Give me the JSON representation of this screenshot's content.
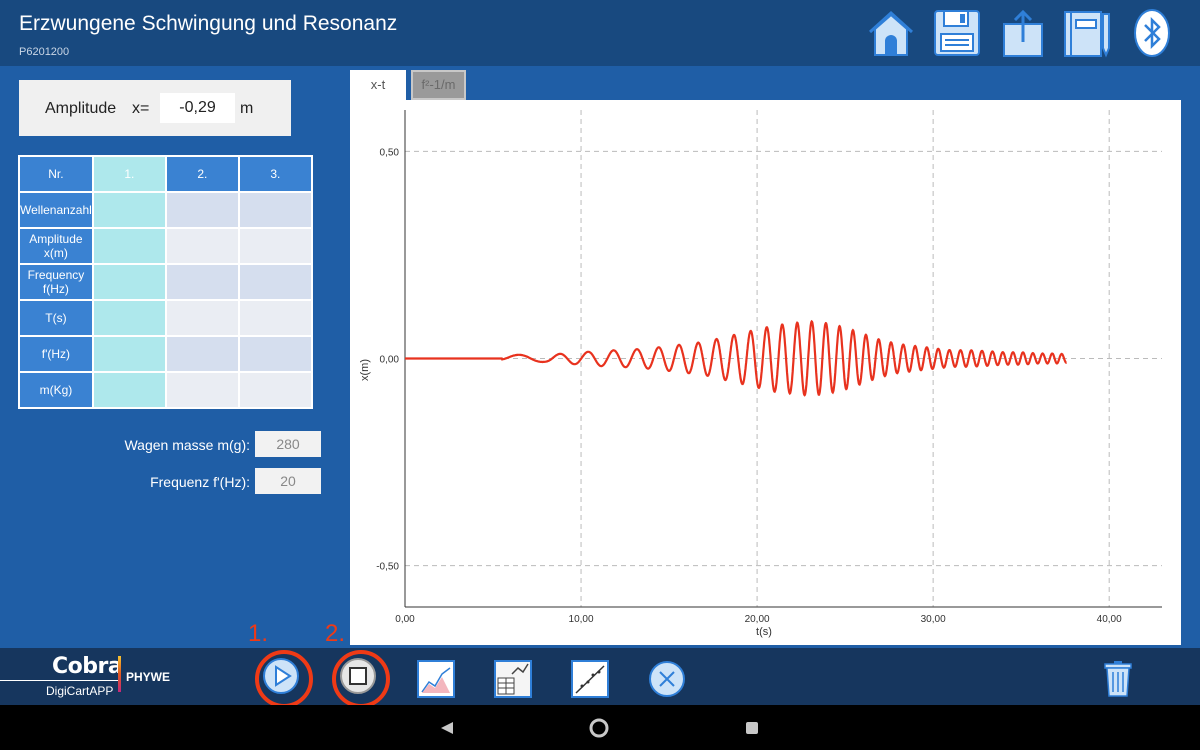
{
  "header": {
    "title": "Erzwungene Schwingung und Resonanz",
    "subtitle": "P6201200",
    "icons": [
      "home-icon",
      "save-icon",
      "export-icon",
      "notebook-icon",
      "bluetooth-icon"
    ]
  },
  "amplitude": {
    "label": "Amplitude",
    "var": "x=",
    "value": "-0,29",
    "unit": "m"
  },
  "table": {
    "corner": "Nr.",
    "columns": [
      "1.",
      "2.",
      "3."
    ],
    "rows": [
      "Wellenanzahl",
      "Amplitude x(m)",
      "Frequency f(Hz)",
      "T(s)",
      "f'(Hz)",
      "m(Kg)"
    ]
  },
  "fields": {
    "mass_label": "Wagen masse m(g):",
    "mass_value": "280",
    "freq_label": "Frequenz f'(Hz):",
    "freq_value": "20"
  },
  "tabs": {
    "xt": "x-t",
    "f2": "f²-1/m"
  },
  "chart_data": {
    "type": "line",
    "xlabel": "t(s)",
    "ylabel": "x(m)",
    "xlim": [
      0,
      43
    ],
    "ylim": [
      -0.6,
      0.6
    ],
    "x_ticks": [
      "0,00",
      "10,00",
      "20,00",
      "30,00",
      "40,00"
    ],
    "y_ticks": [
      "0,50",
      "0,00",
      "-0,50"
    ],
    "grid": true,
    "color": "#e8321e",
    "series": [
      {
        "x": [
          0,
          5,
          5.5,
          6,
          7,
          8,
          9,
          10,
          11,
          12,
          13,
          14,
          15,
          16,
          17,
          18,
          19,
          20,
          21,
          22,
          23,
          24,
          25,
          26,
          27,
          28,
          29,
          30,
          31,
          32,
          33,
          34,
          35,
          36,
          37,
          37.6
        ],
        "amp": [
          0,
          0,
          0.005,
          0.008,
          0.01,
          0.008,
          0.012,
          0.015,
          0.018,
          0.02,
          0.022,
          0.025,
          0.03,
          0.035,
          0.04,
          0.05,
          0.06,
          0.07,
          0.08,
          0.085,
          0.09,
          0.085,
          0.075,
          0.06,
          0.045,
          0.035,
          0.03,
          0.025,
          0.02,
          0.02,
          0.018,
          0.015,
          0.015,
          0.012,
          0.012,
          0.01
        ]
      }
    ]
  },
  "bottom": {
    "brand": "Cobra",
    "product": "DigiCartAPP",
    "vendor": "PHYWE",
    "step1": "1.",
    "step2": "2.",
    "icons": [
      "play-icon",
      "stop-icon",
      "chart-icon",
      "table-chart-icon",
      "fit-line-icon",
      "close-icon",
      "trash-icon"
    ]
  },
  "colors": {
    "accent": "#2f7fd8",
    "highlight": "#ef3a16"
  }
}
